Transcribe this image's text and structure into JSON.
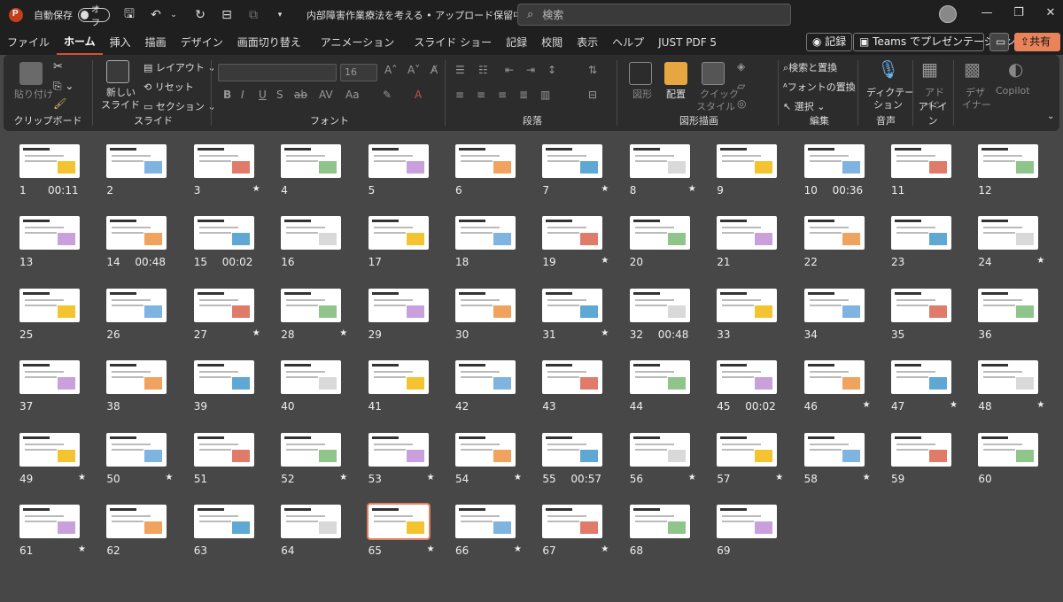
{
  "titlebar": {
    "autosave_label": "自動保存",
    "toggle_state": "オフ",
    "document_title": "内部障害作業療法を考える • アップロード保留中 ⌄",
    "search_placeholder": "検索"
  },
  "tabs": [
    {
      "label": "ファイル"
    },
    {
      "label": "ホーム",
      "active": true
    },
    {
      "label": "挿入"
    },
    {
      "label": "描画"
    },
    {
      "label": "デザイン"
    },
    {
      "label": "画面切り替え"
    },
    {
      "label": "アニメーション"
    },
    {
      "label": "スライド ショー"
    },
    {
      "label": "記録"
    },
    {
      "label": "校閲"
    },
    {
      "label": "表示"
    },
    {
      "label": "ヘルプ"
    },
    {
      "label": "JUST PDF 5"
    }
  ],
  "tab_actions": {
    "record": "◉ 記録",
    "teams": "Teams でプレゼンテーション",
    "share": "共有"
  },
  "ribbon": {
    "paste": "貼り付け",
    "clipboard": "クリップボード",
    "new_slide_1": "新しい",
    "new_slide_2": "スライド",
    "layout": "レイアウト",
    "reset": "リセット",
    "section": "セクション",
    "slide_group": "スライド",
    "font_size": "16",
    "font_group": "フォント",
    "paragraph_group": "段落",
    "shapes": "図形",
    "arrange": "配置",
    "quick_styles_1": "クイック",
    "quick_styles_2": "スタイル",
    "drawing_group": "図形描画",
    "find_replace": "検索と置換",
    "replace_font": "フォントの置換",
    "select": "選択",
    "edit_group": "編集",
    "dictate_1": "ディクテー",
    "dictate_2": "ション",
    "voice_group": "音声",
    "addins_1": "アド",
    "addins_2": "イン",
    "addins_group": "アドイン",
    "designer_1": "デザ",
    "designer_2": "イナー",
    "copilot": "Copilot"
  },
  "slides": [
    {
      "n": "1",
      "time": "00:11",
      "star": ""
    },
    {
      "n": "2",
      "time": "",
      "star": ""
    },
    {
      "n": "3",
      "time": "",
      "star": "★"
    },
    {
      "n": "4",
      "time": "",
      "star": ""
    },
    {
      "n": "5",
      "time": "",
      "star": ""
    },
    {
      "n": "6",
      "time": "",
      "star": ""
    },
    {
      "n": "7",
      "time": "",
      "star": "★"
    },
    {
      "n": "8",
      "time": "",
      "star": "★"
    },
    {
      "n": "9",
      "time": "",
      "star": ""
    },
    {
      "n": "10",
      "time": "00:36",
      "star": ""
    },
    {
      "n": "11",
      "time": "",
      "star": ""
    },
    {
      "n": "12",
      "time": "",
      "star": ""
    },
    {
      "n": "13",
      "time": "",
      "star": ""
    },
    {
      "n": "14",
      "time": "00:48",
      "star": ""
    },
    {
      "n": "15",
      "time": "00:02",
      "star": ""
    },
    {
      "n": "16",
      "time": "",
      "star": ""
    },
    {
      "n": "17",
      "time": "",
      "star": ""
    },
    {
      "n": "18",
      "time": "",
      "star": ""
    },
    {
      "n": "19",
      "time": "",
      "star": "★"
    },
    {
      "n": "20",
      "time": "",
      "star": ""
    },
    {
      "n": "21",
      "time": "",
      "star": ""
    },
    {
      "n": "22",
      "time": "",
      "star": ""
    },
    {
      "n": "23",
      "time": "",
      "star": ""
    },
    {
      "n": "24",
      "time": "",
      "star": "★"
    },
    {
      "n": "25",
      "time": "",
      "star": ""
    },
    {
      "n": "26",
      "time": "",
      "star": ""
    },
    {
      "n": "27",
      "time": "",
      "star": "★"
    },
    {
      "n": "28",
      "time": "",
      "star": "★"
    },
    {
      "n": "29",
      "time": "",
      "star": ""
    },
    {
      "n": "30",
      "time": "",
      "star": ""
    },
    {
      "n": "31",
      "time": "",
      "star": "★"
    },
    {
      "n": "32",
      "time": "00:48",
      "star": ""
    },
    {
      "n": "33",
      "time": "",
      "star": ""
    },
    {
      "n": "34",
      "time": "",
      "star": ""
    },
    {
      "n": "35",
      "time": "",
      "star": ""
    },
    {
      "n": "36",
      "time": "",
      "star": ""
    },
    {
      "n": "37",
      "time": "",
      "star": ""
    },
    {
      "n": "38",
      "time": "",
      "star": ""
    },
    {
      "n": "39",
      "time": "",
      "star": ""
    },
    {
      "n": "40",
      "time": "",
      "star": ""
    },
    {
      "n": "41",
      "time": "",
      "star": ""
    },
    {
      "n": "42",
      "time": "",
      "star": ""
    },
    {
      "n": "43",
      "time": "",
      "star": ""
    },
    {
      "n": "44",
      "time": "",
      "star": ""
    },
    {
      "n": "45",
      "time": "00:02",
      "star": ""
    },
    {
      "n": "46",
      "time": "",
      "star": "★"
    },
    {
      "n": "47",
      "time": "",
      "star": "★"
    },
    {
      "n": "48",
      "time": "",
      "star": "★"
    },
    {
      "n": "49",
      "time": "",
      "star": "★"
    },
    {
      "n": "50",
      "time": "",
      "star": "★"
    },
    {
      "n": "51",
      "time": "",
      "star": ""
    },
    {
      "n": "52",
      "time": "",
      "star": "★"
    },
    {
      "n": "53",
      "time": "",
      "star": "★"
    },
    {
      "n": "54",
      "time": "",
      "star": "★"
    },
    {
      "n": "55",
      "time": "00:57",
      "star": ""
    },
    {
      "n": "56",
      "time": "",
      "star": "★"
    },
    {
      "n": "57",
      "time": "",
      "star": "★"
    },
    {
      "n": "58",
      "time": "",
      "star": "★"
    },
    {
      "n": "59",
      "time": "",
      "star": ""
    },
    {
      "n": "60",
      "time": "",
      "star": ""
    },
    {
      "n": "61",
      "time": "",
      "star": "★"
    },
    {
      "n": "62",
      "time": "",
      "star": ""
    },
    {
      "n": "63",
      "time": "",
      "star": ""
    },
    {
      "n": "64",
      "time": "",
      "star": ""
    },
    {
      "n": "65",
      "time": "",
      "star": "★"
    },
    {
      "n": "66",
      "time": "",
      "star": "★"
    },
    {
      "n": "67",
      "time": "",
      "star": "★"
    },
    {
      "n": "68",
      "time": "",
      "star": ""
    },
    {
      "n": "69",
      "time": "",
      "star": ""
    }
  ],
  "selected_slide": "65",
  "colors": {
    "accent": "#d35230",
    "share_bg": "#e8835a"
  }
}
